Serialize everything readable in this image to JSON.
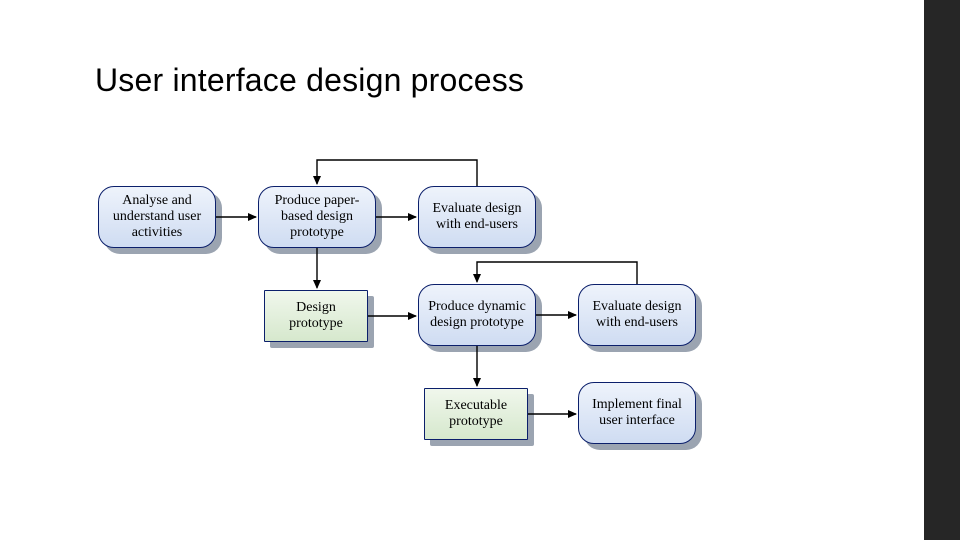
{
  "title": "User interface design process",
  "nodes": {
    "analyse": {
      "label": "Analyse and understand user activities"
    },
    "paper": {
      "label": "Produce paper-based design prototype"
    },
    "eval1": {
      "label": "Evaluate design with end-users"
    },
    "designp": {
      "label": "Design prototype"
    },
    "dynamic": {
      "label": "Produce dynamic design prototype"
    },
    "eval2": {
      "label": "Evaluate design with end-users"
    },
    "exec": {
      "label": "Executable prototype"
    },
    "implement": {
      "label": "Implement final user interface"
    }
  },
  "arrows": [
    {
      "from": "analyse",
      "to": "paper",
      "kind": "right"
    },
    {
      "from": "paper",
      "to": "eval1",
      "kind": "right"
    },
    {
      "from": "eval1",
      "to": "paper",
      "kind": "feedback-top"
    },
    {
      "from": "paper",
      "to": "designp",
      "kind": "down"
    },
    {
      "from": "designp",
      "to": "dynamic",
      "kind": "right"
    },
    {
      "from": "dynamic",
      "to": "eval2",
      "kind": "right"
    },
    {
      "from": "eval2",
      "to": "dynamic",
      "kind": "feedback-top"
    },
    {
      "from": "dynamic",
      "to": "exec",
      "kind": "down"
    },
    {
      "from": "exec",
      "to": "implement",
      "kind": "right"
    }
  ],
  "colors": {
    "shadow": "#8a94a3",
    "round_border": "#0b1f6b",
    "round_fill_top": "#eef3fb",
    "round_fill_bot": "#cfdcf2",
    "rect_fill_top": "#f0f7ec",
    "rect_fill_bot": "#d6e8cd",
    "sidebar": "#262626",
    "arrow": "#000000"
  }
}
